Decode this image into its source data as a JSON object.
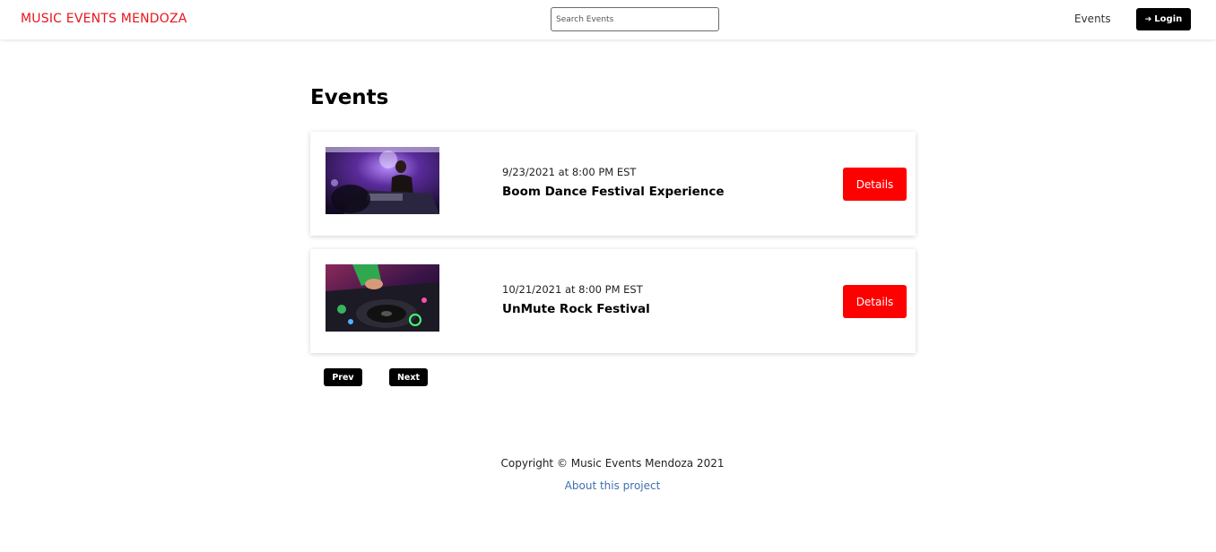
{
  "navbar": {
    "brand": "MUSIC EVENTS MENDOZA",
    "search_placeholder": "Search Events",
    "events_link": "Events",
    "login_label": "Login",
    "login_icon": "sign-in-icon"
  },
  "page": {
    "title": "Events"
  },
  "events": [
    {
      "date": "9/23/2021 at 8:00 PM EST",
      "title": "Boom Dance Festival Experience",
      "details_label": "Details",
      "image": "dj-performing-photo"
    },
    {
      "date": "10/21/2021 at 8:00 PM EST",
      "title": "UnMute Rock Festival",
      "details_label": "Details",
      "image": "dj-mixer-photo"
    }
  ],
  "pagination": {
    "prev_label": "Prev",
    "next_label": "Next"
  },
  "footer": {
    "copyright": "Copyright © Music Events Mendoza 2021",
    "about_link": "About this project"
  },
  "colors": {
    "brand": "#e8141b",
    "details_button": "#ff0000",
    "dark_button": "#000000",
    "link": "#3f6fb0"
  }
}
